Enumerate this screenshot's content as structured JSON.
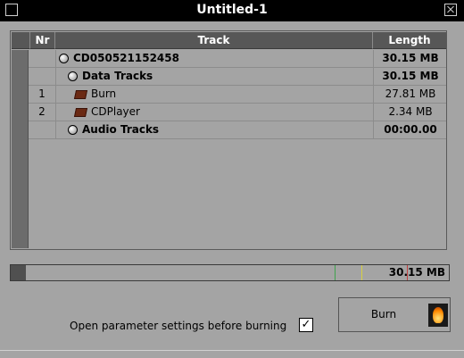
{
  "window": {
    "title": "Untitled-1"
  },
  "table": {
    "headers": {
      "nr": "Nr",
      "track": "Track",
      "length": "Length"
    },
    "rows": [
      {
        "nr": "",
        "name": "CD050521152458",
        "length": "30.15 MB",
        "icon": "disc-icon",
        "bold": true,
        "indent": 0
      },
      {
        "nr": "",
        "name": "Data Tracks",
        "length": "30.15 MB",
        "icon": "disc-icon",
        "bold": true,
        "indent": 1
      },
      {
        "nr": "1",
        "name": "Burn",
        "length": "27.81 MB",
        "icon": "folder-icon",
        "bold": false,
        "indent": 2
      },
      {
        "nr": "2",
        "name": "CDPlayer",
        "length": "2.34 MB",
        "icon": "folder-icon",
        "bold": false,
        "indent": 2
      },
      {
        "nr": "",
        "name": "Audio Tracks",
        "length": "00:00.00",
        "icon": "disc-icon",
        "bold": true,
        "indent": 1
      }
    ]
  },
  "capacity": {
    "used_text": "30.15 MB",
    "fill_fraction": 0.035,
    "marks": [
      {
        "at": 0.74,
        "color": "#3fa34d"
      },
      {
        "at": 0.8,
        "color": "#d8d040"
      },
      {
        "at": 0.905,
        "color": "#c04040"
      }
    ]
  },
  "burn_button": {
    "label": "Burn"
  },
  "options": {
    "open_params_label": "Open parameter settings before burning",
    "open_params_checked": "✓"
  }
}
